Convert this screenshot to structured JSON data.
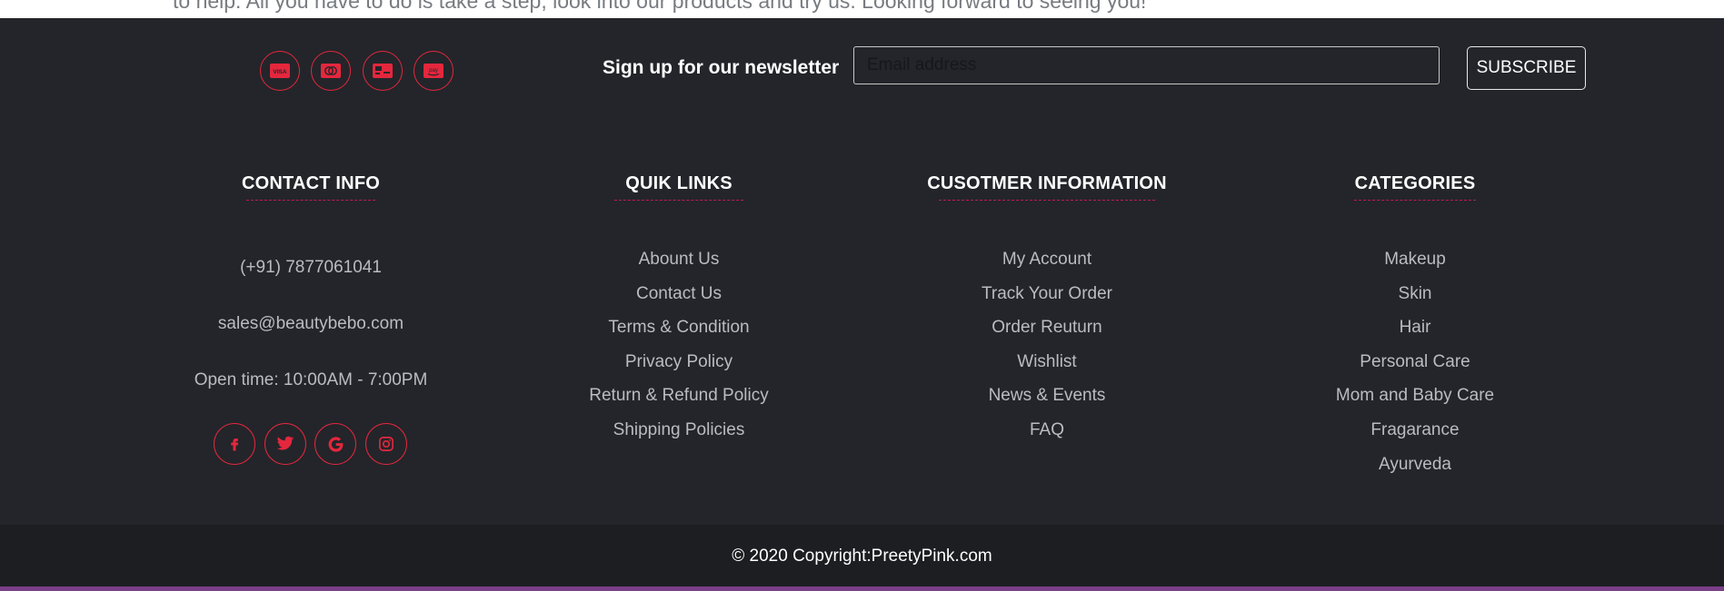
{
  "intro_text": "to help. All you have to do is take a step, look into our products and try us. Looking forward to seeing you!",
  "payment_icons": [
    "visa-card-icon",
    "mastercard-icon",
    "discover-card-icon",
    "amazon-pay-icon"
  ],
  "newsletter": {
    "label": "Sign up for our newsletter",
    "placeholder": "Email address",
    "button_label": "SUBSCRIBE"
  },
  "contact": {
    "title": "CONTACT INFO",
    "phone": "(+91) 7877061041",
    "email": "sales@beautybebo.com",
    "hours": "Open time: 10:00AM - 7:00PM",
    "social_icons": [
      "facebook-icon",
      "twitter-icon",
      "google-icon",
      "instagram-icon"
    ]
  },
  "quick_links": {
    "title": "QUIK LINKS",
    "items": [
      "Abount Us",
      "Contact Us",
      "Terms & Condition",
      "Privacy Policy",
      "Return & Refund Policy",
      "Shipping Policies"
    ]
  },
  "customer_info": {
    "title": "CUSOTMER INFORMATION",
    "items": [
      "My Account",
      "Track Your Order",
      "Order Reuturn",
      "Wishlist",
      "News & Events",
      "FAQ"
    ]
  },
  "categories": {
    "title": "CATEGORIES",
    "items": [
      "Makeup",
      "Skin",
      "Hair",
      "Personal Care",
      "Mom and Baby Care",
      "Fragarance",
      "Ayurveda"
    ]
  },
  "copyright": "© 2020 Copyright:PreetyPink.com",
  "colors": {
    "footer_bg": "#23252a",
    "accent_red": "#e4273d",
    "divider_pink": "#c2185b",
    "link_gray": "#b9bcc0",
    "copyright_bg": "#1c1e21",
    "bottom_line": "#7b3f8a"
  }
}
